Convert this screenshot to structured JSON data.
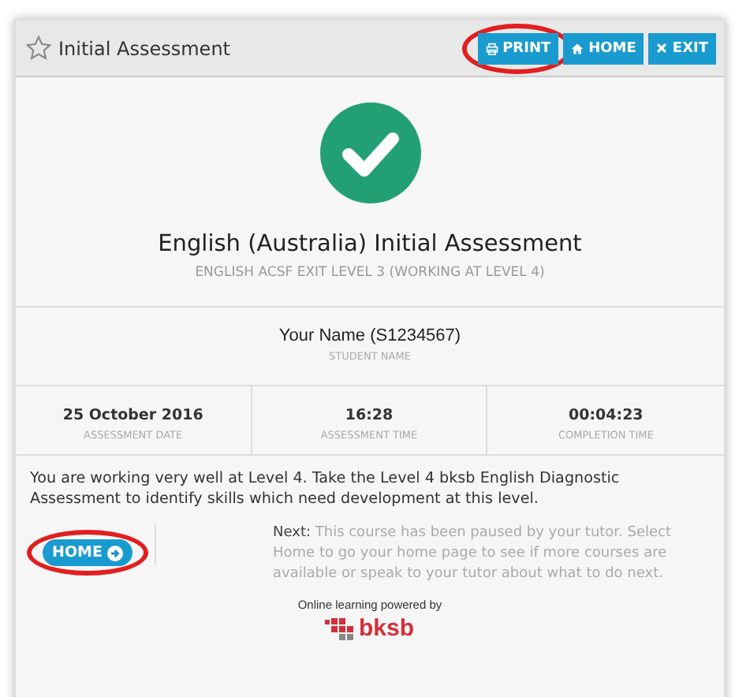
{
  "header": {
    "title": "Initial Assessment",
    "buttons": [
      {
        "kind": "print",
        "label": "PRINT",
        "highlighted": true
      },
      {
        "kind": "home",
        "label": "HOME",
        "highlighted": false
      },
      {
        "kind": "exit",
        "label": "EXIT",
        "highlighted": false
      }
    ]
  },
  "result": {
    "title": "English (Australia) Initial Assessment",
    "subtitle": "ENGLISH ACSF EXIT LEVEL 3 (WORKING AT LEVEL 4)"
  },
  "student": {
    "value": "Your Name (S1234567)",
    "label": "STUDENT NAME"
  },
  "details": [
    {
      "value": "25 October 2016",
      "label": "ASSESSMENT DATE"
    },
    {
      "value": "16:28",
      "label": "ASSESSMENT TIME"
    },
    {
      "value": "00:04:23",
      "label": "COMPLETION TIME"
    }
  ],
  "message": "You are working very well at Level 4. Take the Level 4 bksb English Diagnostic Assessment to identify skills which need development at this level.",
  "home_button": {
    "label": "HOME",
    "highlighted": true
  },
  "next": {
    "label": "Next:",
    "text": "This course has been paused by your tutor. Select Home to go your home page to see if more courses are available or speak to your tutor about what to do next."
  },
  "footer": {
    "powered_by": "Online learning powered by",
    "logo": "bksb"
  }
}
